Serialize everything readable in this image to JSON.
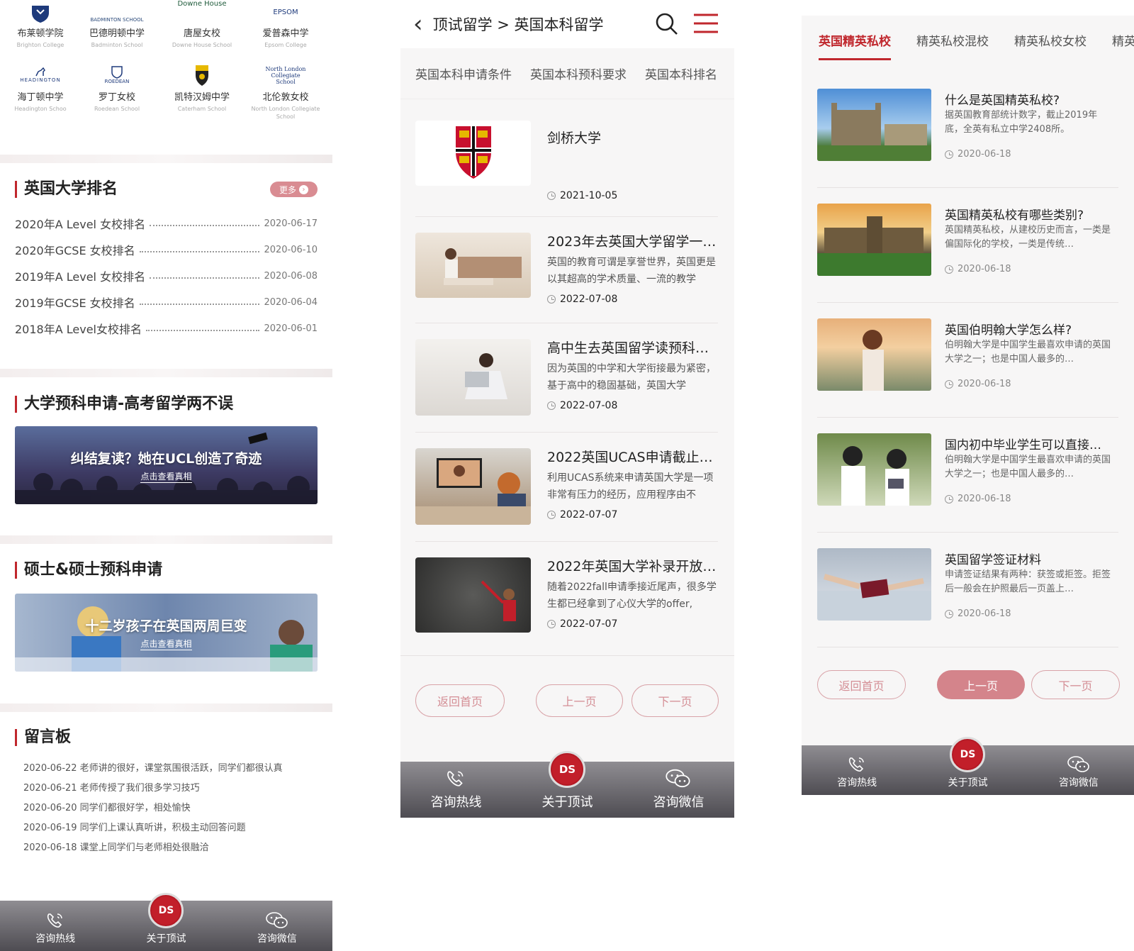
{
  "panel1": {
    "schools": [
      {
        "cn": "布莱顿学院",
        "en": "Brighton College",
        "logo_text": ""
      },
      {
        "cn": "巴德明顿中学",
        "en": "Badminton School",
        "logo_text": "BADMINTON SCHOOL"
      },
      {
        "cn": "唐屋女校",
        "en": "Downe House School",
        "logo_text": "Downe House"
      },
      {
        "cn": "爱普森中学",
        "en": "Epsom College",
        "logo_text": "EPSOM"
      },
      {
        "cn": "海丁顿中学",
        "en": "Headington Schoo",
        "logo_text": "HEADINGTON"
      },
      {
        "cn": "罗丁女校",
        "en": "Roedean School",
        "logo_text": "ROEDEAN"
      },
      {
        "cn": "凯特汉姆中学",
        "en": "Caterham School",
        "logo_text": ""
      },
      {
        "cn": "北伦敦女校",
        "en": "North London Collegiate School",
        "logo_text": "North London Collegiate School"
      }
    ],
    "ranking": {
      "title": "英国大学排名",
      "more": "更多",
      "rows": [
        {
          "label": "2020年A Level 女校排名",
          "date": "2020-06-17"
        },
        {
          "label": "2020年GCSE 女校排名",
          "date": "2020-06-10"
        },
        {
          "label": "2019年A Level 女校排名",
          "date": "2020-06-08"
        },
        {
          "label": "2019年GCSE 女校排名",
          "date": "2020-06-04"
        },
        {
          "label": "2018年A Level女校排名",
          "date": "2020-06-01"
        }
      ]
    },
    "prep": {
      "title": "大学预科申请-高考留学两不误",
      "banner_title": "纠结复读？她在UCL创造了奇迹",
      "banner_sub": "点击查看真相"
    },
    "master": {
      "title": "硕士&硕士预科申请",
      "banner_title": "十二岁孩子在英国两周巨变",
      "banner_sub": "点击查看真相"
    },
    "board": {
      "title": "留言板",
      "messages": [
        "2020-06-22 老师讲的很好，课堂氛围很活跃，同学们都很认真",
        "2020-06-21 老师传授了我们很多学习技巧",
        "2020-06-20 同学们都很好学，相处愉快",
        "2020-06-19 同学们上课认真听讲，积极主动回答问题",
        "2020-06-18 课堂上同学们与老师相处很融洽"
      ]
    },
    "tabbar": {
      "hotline": "咨询热线",
      "about": "关于顶试",
      "wechat": "咨询微信",
      "badge": "DS"
    }
  },
  "panel2": {
    "breadcrumb": "顶试留学 > 英国本科留学",
    "tabs": [
      "英国本科申请条件",
      "英国本科预科要求",
      "英国本科排名"
    ],
    "articles": [
      {
        "title": "剑桥大学",
        "desc": "",
        "date": "2021-10-05"
      },
      {
        "title": "2023年去英国大学留学一…",
        "desc": "英国的教育可谓是享誉世界，英国更是以其超高的学术质量、一流的教学",
        "date": "2022-07-08"
      },
      {
        "title": "高中生去英国留学读预科…",
        "desc": "因为英国的中学和大学衔接最为紧密，基于高中的稳固基础，英国大学",
        "date": "2022-07-08"
      },
      {
        "title": "2022英国UCAS申请截止…",
        "desc": "利用UCAS系统来申请英国大学是一项非常有压力的经历，应用程序由不",
        "date": "2022-07-07"
      },
      {
        "title": "2022年英国大学补录开放…",
        "desc": "随着2022fall申请季接近尾声，很多学生都已经拿到了心仪大学的offer,",
        "date": "2022-07-07"
      }
    ],
    "pager": {
      "home": "返回首页",
      "prev": "上一页",
      "next": "下一页"
    },
    "tabbar": {
      "hotline": "咨询热线",
      "about": "关于顶试",
      "wechat": "咨询微信",
      "badge": "DS"
    }
  },
  "panel3": {
    "tabs": [
      "英国精英私校",
      "精英私校混校",
      "精英私校女校",
      "精英私校男校"
    ],
    "items": [
      {
        "title": "什么是英国精英私校?",
        "desc": "据英国教育部统计数字，截止2019年底，全英有私立中学2408所。",
        "date": "2020-06-18"
      },
      {
        "title": "英国精英私校有哪些类别?",
        "desc": "英国精英私校，从建校历史而言，一类是偏国际化的学校，一类是传统…",
        "date": "2020-06-18"
      },
      {
        "title": "英国伯明翰大学怎么样?",
        "desc": "伯明翰大学是中国学生最喜欢申请的英国大学之一；也是中国人最多的…",
        "date": "2020-06-18"
      },
      {
        "title": "国内初中毕业学生可以直接…",
        "desc": "伯明翰大学是中国学生最喜欢申请的英国大学之一；也是中国人最多的…",
        "date": "2020-06-18"
      },
      {
        "title": "英国留学签证材料",
        "desc": "申请签证结果有两种：获签或拒签。拒签后一般会在护照最后一页盖上…",
        "date": "2020-06-18"
      }
    ],
    "pager": {
      "home": "返回首页",
      "prev": "上一页",
      "next": "下一页"
    },
    "tabbar": {
      "hotline": "咨询热线",
      "about": "关于顶试",
      "wechat": "咨询微信",
      "badge": "DS"
    }
  },
  "colors": {
    "accent": "#c0272d",
    "pink": "#d4848b",
    "tabbar": "#6b696e"
  }
}
